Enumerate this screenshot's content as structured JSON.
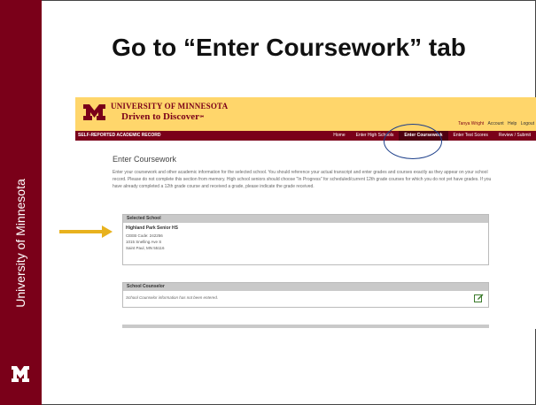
{
  "sidebar": {
    "label": "University of Minnesota"
  },
  "slide": {
    "title": "Go to “Enter Coursework” tab"
  },
  "umn": {
    "name_line1": "UNIVERSITY OF MINNESOTA",
    "name_line2": "Driven to Discover",
    "trademark": "℠"
  },
  "user_links": {
    "user": "Tanya Wright",
    "account": "Account",
    "help": "Help",
    "logout": "Logout"
  },
  "nav": {
    "title": "SELF-REPORTED ACADEMIC RECORD",
    "tabs": [
      "Home",
      "Enter High Schools",
      "Enter Coursework",
      "Enter Test Scores",
      "Review / Submit"
    ]
  },
  "content": {
    "title": "Enter Coursework",
    "intro": "Enter your coursework and other academic information for the selected school. You should reference your actual transcript and enter grades and courses exactly as they appear on your school record. Please do not complete this section from memory. High school seniors should choose \"In Progress\" for scheduled/current 12th grade courses for which you do not yet have grades. If you have already completed a 12th grade course and received a grade, please indicate the grade received."
  },
  "selected_school": {
    "heading": "Selected School",
    "name": "Highland Park Senior HS",
    "ceeb": "CEEB Code: 242256",
    "address1": "1015 Snelling Ave S",
    "address2": "Saint Paul, MN 55116"
  },
  "counselor": {
    "heading": "School Counselor",
    "note": "School Counselor information has not been entered."
  },
  "colors": {
    "maroon": "#7a0019",
    "gold": "#ffd66b",
    "arrow": "#e8b21e",
    "circle": "#1c3f8a"
  }
}
